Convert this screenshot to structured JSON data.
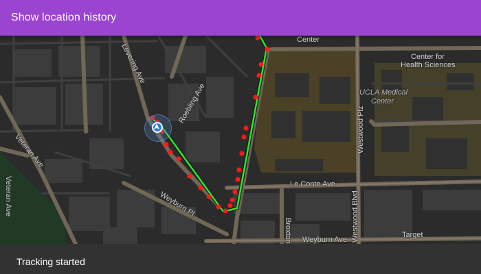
{
  "app_bar": {
    "title": "Show location history"
  },
  "status_bar": {
    "message": "Tracking started"
  },
  "map": {
    "labels": {
      "center": "Center",
      "center_for_health_sciences_1": "Center for",
      "center_for_health_sciences_2": "Health Sciences",
      "ucla_medical_center_1": "UCLA Medical",
      "ucla_medical_center_2": "Center",
      "levering_ave": "Levering Ave",
      "roebling_ave": "Roebling Ave",
      "veteran_ave_diag": "Veteran Ave",
      "veteran_ave_vert": "Veteran Ave",
      "westwood_plz": "Westwood Plz",
      "le_conte_ave": "Le Conte Ave",
      "weyburn_pl": "Weyburn Pl",
      "broxton": "Broxton",
      "westwood_blvd": "Westwood Blvd",
      "weyburn_ave": "Weyburn Ave",
      "target": "Target"
    },
    "icons": {
      "location_marker": "navigation-arrow-icon"
    },
    "colors": {
      "track_line": "#2ee62e",
      "history_points": "#ff1a1a",
      "location_marker": "#2f7bd8",
      "app_bar": "#9a44cf",
      "campus_fill": "#4a4126",
      "park_fill": "#203a25"
    }
  }
}
